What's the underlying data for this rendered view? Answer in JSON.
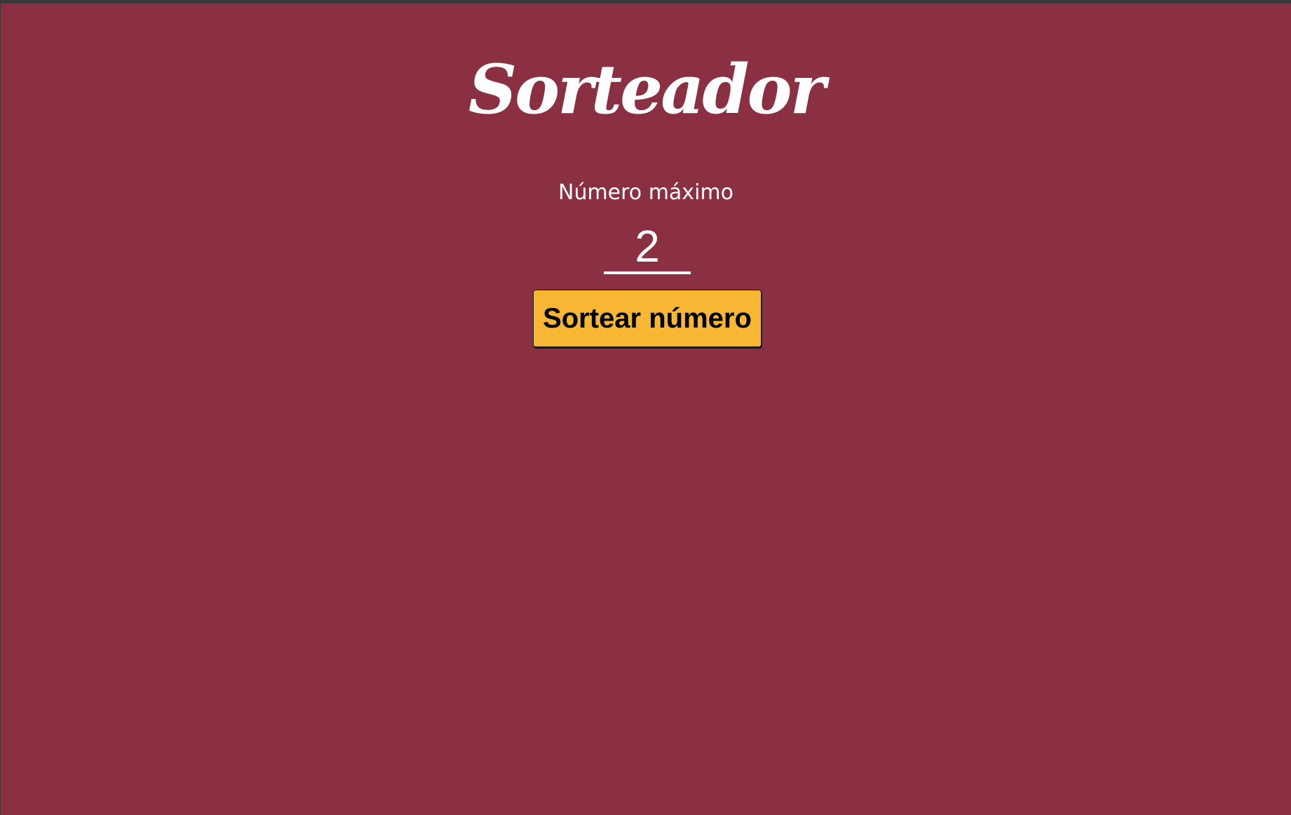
{
  "app": {
    "title": "Sorteador"
  },
  "form": {
    "max_label": "Número máximo",
    "max_value": "2",
    "draw_button_label": "Sortear número"
  },
  "colors": {
    "background": "#8b3042",
    "button": "#f7b733",
    "text": "#ffffff"
  }
}
